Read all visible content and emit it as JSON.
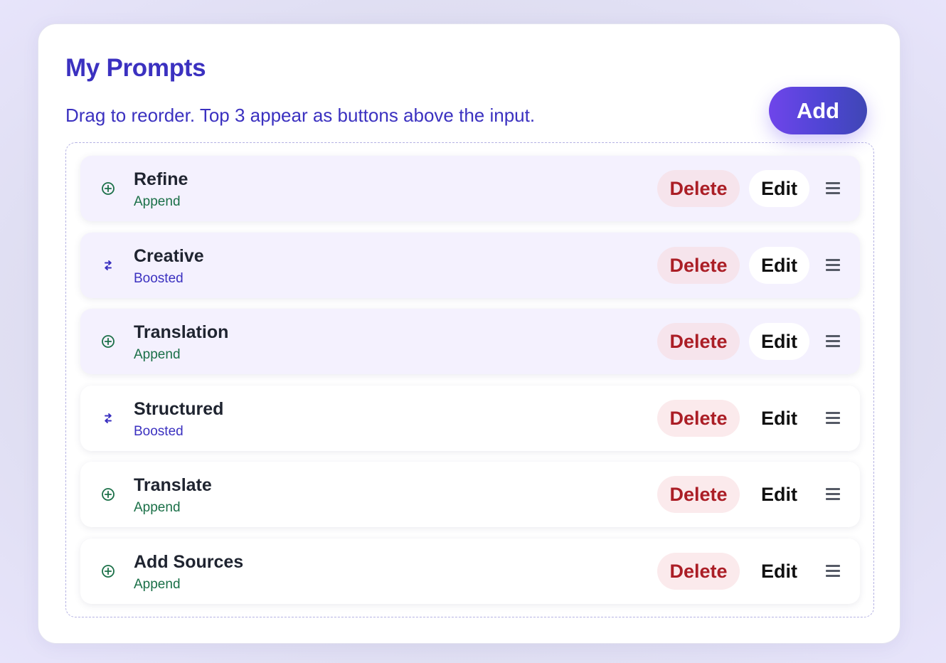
{
  "header": {
    "title": "My Prompts",
    "subtitle": "Drag to reorder. Top 3 appear as buttons above the input.",
    "add_label": "Add"
  },
  "prompts": [
    {
      "name": "Refine",
      "type": "Append",
      "icon": "plus-circle-icon",
      "pinned": true,
      "delete_label": "Delete",
      "edit_label": "Edit"
    },
    {
      "name": "Creative",
      "type": "Boosted",
      "icon": "swap-arrows-icon",
      "pinned": true,
      "delete_label": "Delete",
      "edit_label": "Edit"
    },
    {
      "name": "Translation",
      "type": "Append",
      "icon": "plus-circle-icon",
      "pinned": true,
      "delete_label": "Delete",
      "edit_label": "Edit"
    },
    {
      "name": "Structured",
      "type": "Boosted",
      "icon": "swap-arrows-icon",
      "pinned": false,
      "delete_label": "Delete",
      "edit_label": "Edit"
    },
    {
      "name": "Translate",
      "type": "Append",
      "icon": "plus-circle-icon",
      "pinned": false,
      "delete_label": "Delete",
      "edit_label": "Edit"
    },
    {
      "name": "Add Sources",
      "type": "Append",
      "icon": "plus-circle-icon",
      "pinned": false,
      "delete_label": "Delete",
      "edit_label": "Edit"
    }
  ],
  "colors": {
    "accent": "#3b31c0",
    "append": "#1b7048",
    "boosted": "#3b31c0",
    "delete": "#ab1e26",
    "pinned_background": "#f4f1fe"
  }
}
